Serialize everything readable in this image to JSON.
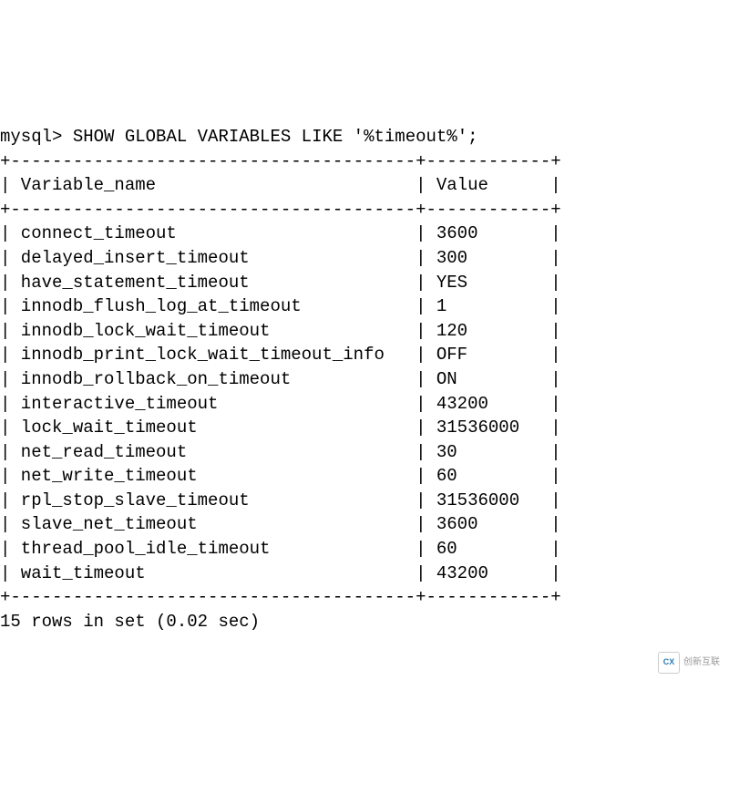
{
  "prompt": "mysql>",
  "command": "SHOW GLOBAL VARIABLES LIKE '%timeout%';",
  "header": {
    "col1": "Variable_name",
    "col2": "Value"
  },
  "rows": [
    {
      "name": "connect_timeout",
      "value": "3600"
    },
    {
      "name": "delayed_insert_timeout",
      "value": "300"
    },
    {
      "name": "have_statement_timeout",
      "value": "YES"
    },
    {
      "name": "innodb_flush_log_at_timeout",
      "value": "1"
    },
    {
      "name": "innodb_lock_wait_timeout",
      "value": "120"
    },
    {
      "name": "innodb_print_lock_wait_timeout_info",
      "value": "OFF"
    },
    {
      "name": "innodb_rollback_on_timeout",
      "value": "ON"
    },
    {
      "name": "interactive_timeout",
      "value": "43200"
    },
    {
      "name": "lock_wait_timeout",
      "value": "31536000"
    },
    {
      "name": "net_read_timeout",
      "value": "30"
    },
    {
      "name": "net_write_timeout",
      "value": "60"
    },
    {
      "name": "rpl_stop_slave_timeout",
      "value": "31536000"
    },
    {
      "name": "slave_net_timeout",
      "value": "3600"
    },
    {
      "name": "thread_pool_idle_timeout",
      "value": "60"
    },
    {
      "name": "wait_timeout",
      "value": "43200"
    }
  ],
  "footer": "15 rows in set (0.02 sec)",
  "col1_width": 37,
  "col2_width": 10,
  "watermark": {
    "logo_text": "CX",
    "text": "创新互联"
  }
}
